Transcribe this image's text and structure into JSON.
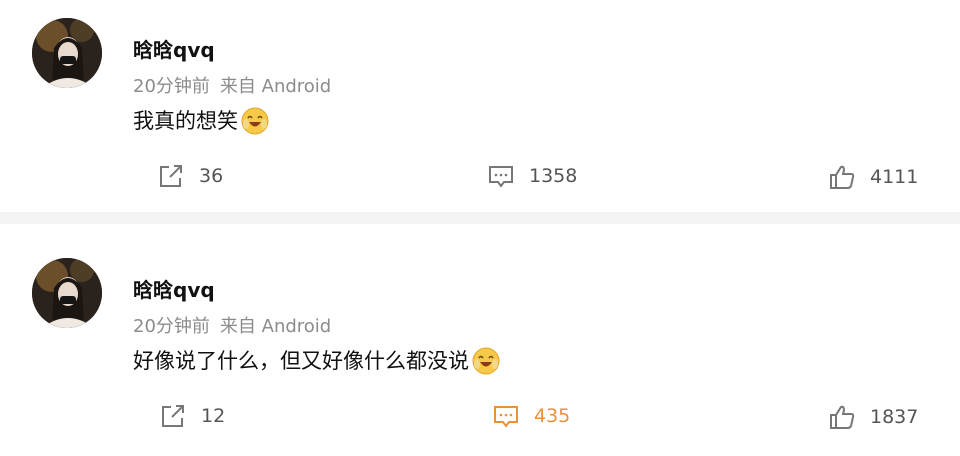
{
  "posts": [
    {
      "user": "晗晗qvq",
      "time": "20分钟前",
      "source": "来自 Android",
      "text": "我真的想笑",
      "emoji": "laughing-face",
      "reposts": "36",
      "comments": "1358",
      "likes": "4111",
      "comments_active": false
    },
    {
      "user": "晗晗qvq",
      "time": "20分钟前",
      "source": "来自 Android",
      "text": "好像说了什么，但又好像什么都没说",
      "emoji": "laughing-face",
      "reposts": "12",
      "comments": "435",
      "likes": "1837",
      "comments_active": true
    }
  ],
  "colors": {
    "active": "#e8923a",
    "muted": "#8c8c8c",
    "divider": "#f3f3f3"
  },
  "icons": [
    "share-icon",
    "comment-icon",
    "like-icon"
  ]
}
